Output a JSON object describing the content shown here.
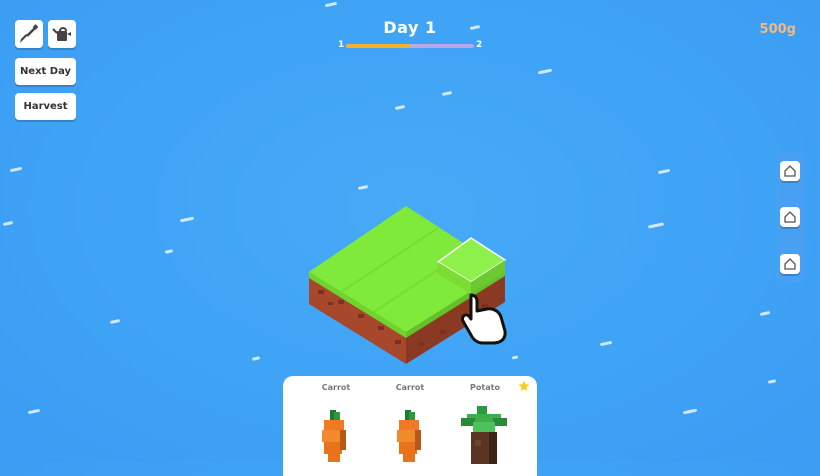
{
  "hud": {
    "day_label": "Day 1",
    "progress_start": "1",
    "progress_end": "2",
    "progress_fraction": 0.5,
    "gold": "500g"
  },
  "toolbar": {
    "tools": [
      {
        "icon": "shovel-icon"
      },
      {
        "icon": "watering-can-icon"
      }
    ],
    "next_day_label": "Next Day",
    "harvest_label": "Harvest"
  },
  "side_menu": {
    "buttons": [
      {
        "icon": "house-icon"
      },
      {
        "icon": "house-icon"
      },
      {
        "icon": "house-icon"
      }
    ]
  },
  "seed_tray": {
    "items": [
      {
        "name": "Carrot"
      },
      {
        "name": "Carrot"
      },
      {
        "name": "Potato"
      }
    ],
    "star_icon": "star-icon"
  },
  "colors": {
    "water": "#3fa3f6",
    "grass": "#80ea3c",
    "soil": "#a7472b",
    "gold_text": "#f6b77f",
    "progress_fill": "#f4b32d",
    "progress_track": "#b9a7ec"
  }
}
